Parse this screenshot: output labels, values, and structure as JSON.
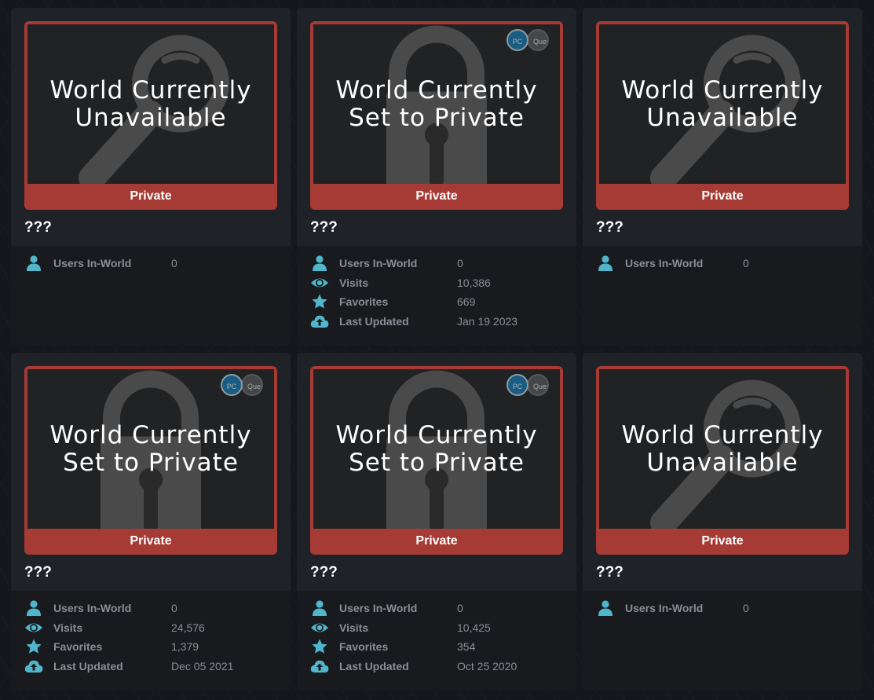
{
  "colors": {
    "status_private": "#a63a35",
    "icon_accent": "#4fb6cc",
    "card_bg": "#1f2227",
    "info_bg": "#181a1e"
  },
  "cards": [
    {
      "overlay": "World Currently\nUnavailable",
      "background_icon": "magnifier-icon",
      "status": "Private",
      "platforms": null,
      "title": "???",
      "stats": [
        {
          "icon": "user-icon",
          "label": "Users In-World",
          "value": "0"
        }
      ]
    },
    {
      "overlay": "World Currently\nSet to Private",
      "background_icon": "lock-icon",
      "status": "Private",
      "platforms": {
        "pc": "PC",
        "quest": "Quest"
      },
      "title": "???",
      "stats": [
        {
          "icon": "user-icon",
          "label": "Users In-World",
          "value": "0"
        },
        {
          "icon": "eye-icon",
          "label": "Visits",
          "value": "10,386"
        },
        {
          "icon": "star-icon",
          "label": "Favorites",
          "value": "669"
        },
        {
          "icon": "cloud-upload-icon",
          "label": "Last Updated",
          "value": "Jan 19 2023"
        }
      ]
    },
    {
      "overlay": "World Currently\nUnavailable",
      "background_icon": "magnifier-icon",
      "status": "Private",
      "platforms": null,
      "title": "???",
      "stats": [
        {
          "icon": "user-icon",
          "label": "Users In-World",
          "value": "0"
        }
      ]
    },
    {
      "overlay": "World Currently\nSet to Private",
      "background_icon": "lock-icon",
      "status": "Private",
      "platforms": {
        "pc": "PC",
        "quest": "Quest"
      },
      "title": "???",
      "stats": [
        {
          "icon": "user-icon",
          "label": "Users In-World",
          "value": "0"
        },
        {
          "icon": "eye-icon",
          "label": "Visits",
          "value": "24,576"
        },
        {
          "icon": "star-icon",
          "label": "Favorites",
          "value": "1,379"
        },
        {
          "icon": "cloud-upload-icon",
          "label": "Last Updated",
          "value": "Dec 05 2021"
        }
      ]
    },
    {
      "overlay": "World Currently\nSet to Private",
      "background_icon": "lock-icon",
      "status": "Private",
      "platforms": {
        "pc": "PC",
        "quest": "Quest"
      },
      "title": "???",
      "stats": [
        {
          "icon": "user-icon",
          "label": "Users In-World",
          "value": "0"
        },
        {
          "icon": "eye-icon",
          "label": "Visits",
          "value": "10,425"
        },
        {
          "icon": "star-icon",
          "label": "Favorites",
          "value": "354"
        },
        {
          "icon": "cloud-upload-icon",
          "label": "Last Updated",
          "value": "Oct 25 2020"
        }
      ]
    },
    {
      "overlay": "World Currently\nUnavailable",
      "background_icon": "magnifier-icon",
      "status": "Private",
      "platforms": null,
      "title": "???",
      "stats": [
        {
          "icon": "user-icon",
          "label": "Users In-World",
          "value": "0"
        }
      ]
    }
  ]
}
